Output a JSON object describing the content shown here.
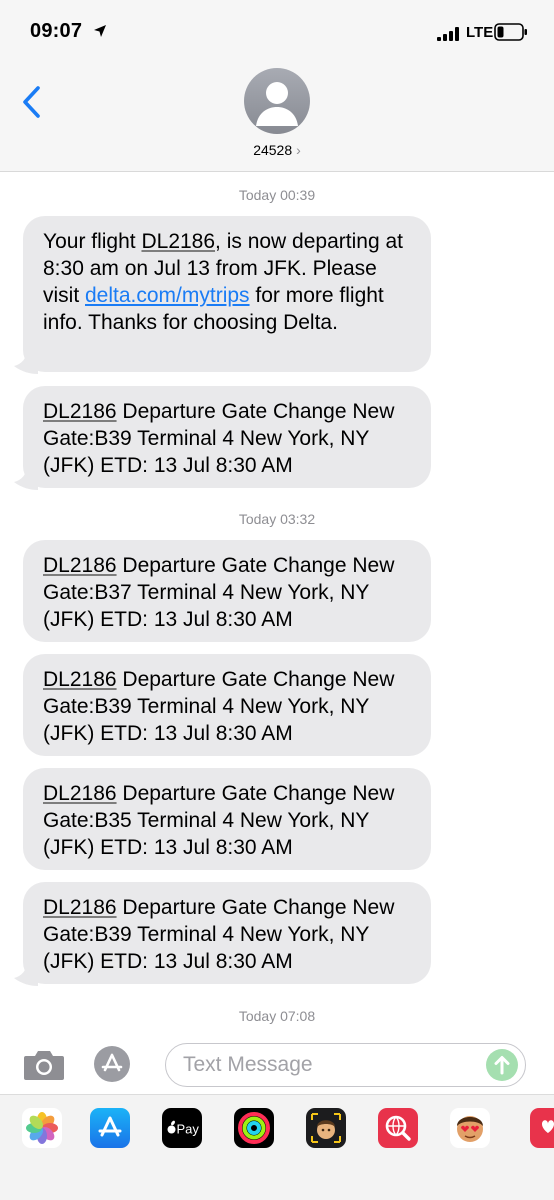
{
  "status_bar": {
    "time": "09:07",
    "network": "LTE"
  },
  "header": {
    "contact_name": "24528",
    "back_icon": "chevron-left-icon",
    "avatar_icon": "person-silhouette-icon"
  },
  "thread": {
    "timestamps": [
      "Today 00:39",
      "Today 03:32",
      "Today 07:08"
    ],
    "messages": [
      {
        "pre": "Your flight ",
        "flight": "DL2186",
        "mid": ", is now departing at 8:30 am on Jul 13 from JFK. Please visit ",
        "link": "delta.com/mytrips",
        "post": " for more flight info. Thanks for choosing Delta."
      },
      {
        "flight": "DL2186",
        "text": " Departure Gate Change New Gate:B39 Terminal 4 New York, NY (JFK) ETD: 13 Jul 8:30 AM"
      },
      {
        "flight": "DL2186",
        "text": " Departure Gate Change New Gate:B37 Terminal 4 New York, NY (JFK) ETD: 13 Jul 8:30 AM"
      },
      {
        "flight": "DL2186",
        "text": " Departure Gate Change New Gate:B39 Terminal 4 New York, NY (JFK) ETD: 13 Jul 8:30 AM"
      },
      {
        "flight": "DL2186",
        "text": " Departure Gate Change New Gate:B35 Terminal 4 New York, NY (JFK) ETD: 13 Jul 8:30 AM"
      },
      {
        "flight": "DL2186",
        "text": " Departure Gate Change New Gate:B39 Terminal 4 New York, NY (JFK) ETD: 13 Jul 8:30 AM"
      }
    ]
  },
  "compose": {
    "placeholder": "Text Message",
    "camera_icon": "camera-icon",
    "apps_icon": "app-store-icon",
    "send_icon": "send-arrow-icon"
  },
  "app_drawer": {
    "apple_pay_label": "Pay",
    "apps": [
      "photos-icon",
      "app-store-icon",
      "apple-pay-icon",
      "activity-icon",
      "memoji-icon",
      "image-search-icon",
      "memoji-stickers-icon",
      "digital-touch-icon"
    ]
  },
  "colors": {
    "bubble": "#e9e9eb",
    "link": "#1a7cf5",
    "timestamp": "#8e8e93",
    "send_disabled": "#a5dfb0"
  }
}
